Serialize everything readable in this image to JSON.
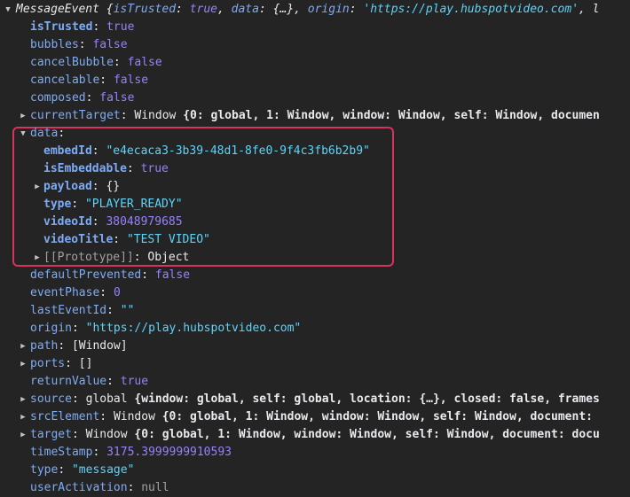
{
  "header": {
    "class_name": "MessageEvent",
    "preview_pre": " {",
    "k1": "isTrusted",
    "v1": "true",
    "k2": "data",
    "v2": "{…}",
    "k3": "origin",
    "v3": "'https://play.hubspotvideo.com'",
    "tail": ", l"
  },
  "rows": {
    "isTrusted": {
      "key": "isTrusted",
      "value": "true"
    },
    "bubbles": {
      "key": "bubbles",
      "value": "false"
    },
    "cancelBubble": {
      "key": "cancelBubble",
      "value": "false"
    },
    "cancelable": {
      "key": "cancelable",
      "value": "false"
    },
    "composed": {
      "key": "composed",
      "value": "false"
    },
    "currentTarget": {
      "key": "currentTarget",
      "type": "Window",
      "preview": " {0: global, 1: Window, window: Window, self: Window, documen"
    },
    "data": {
      "key": "data"
    },
    "embedId": {
      "key": "embedId",
      "value": "\"e4ecaca3-3b39-48d1-8fe0-9f4c3fb6b2b9\""
    },
    "isEmbeddable": {
      "key": "isEmbeddable",
      "value": "true"
    },
    "payload": {
      "key": "payload",
      "value": "{}"
    },
    "type": {
      "key": "type",
      "value": "\"PLAYER_READY\""
    },
    "videoId": {
      "key": "videoId",
      "value": "38048979685"
    },
    "videoTitle": {
      "key": "videoTitle",
      "value": "\"TEST VIDEO\""
    },
    "prototype": {
      "key": "[[Prototype]]",
      "value": "Object"
    },
    "defaultPrevented": {
      "key": "defaultPrevented",
      "value": "false"
    },
    "eventPhase": {
      "key": "eventPhase",
      "value": "0"
    },
    "lastEventId": {
      "key": "lastEventId",
      "value": "\"\""
    },
    "origin": {
      "key": "origin",
      "value": "\"https://play.hubspotvideo.com\""
    },
    "path": {
      "key": "path",
      "value": "[Window]"
    },
    "ports": {
      "key": "ports",
      "value": "[]"
    },
    "returnValue": {
      "key": "returnValue",
      "value": "true"
    },
    "source": {
      "key": "source",
      "type": "global",
      "preview": " {window: global, self: global, location: {…}, closed: false, frames"
    },
    "srcElement": {
      "key": "srcElement",
      "type": "Window",
      "preview": " {0: global, 1: Window, window: Window, self: Window, document:"
    },
    "target": {
      "key": "target",
      "type": "Window",
      "preview": " {0: global, 1: Window, window: Window, self: Window, document: docu"
    },
    "timeStamp": {
      "key": "timeStamp",
      "value": "3175.3999999910593"
    },
    "eventType": {
      "key": "type",
      "value": "\"message\""
    },
    "userActivation": {
      "key": "userActivation",
      "value": "null"
    }
  },
  "icons": {
    "expanded": "triangle-down-icon",
    "collapsed": "triangle-right-icon"
  },
  "colors": {
    "background": "#242424",
    "key": "#7cacf8",
    "string": "#5cd5fb",
    "bool": "#9980ff",
    "highlight": "#d6345c"
  }
}
